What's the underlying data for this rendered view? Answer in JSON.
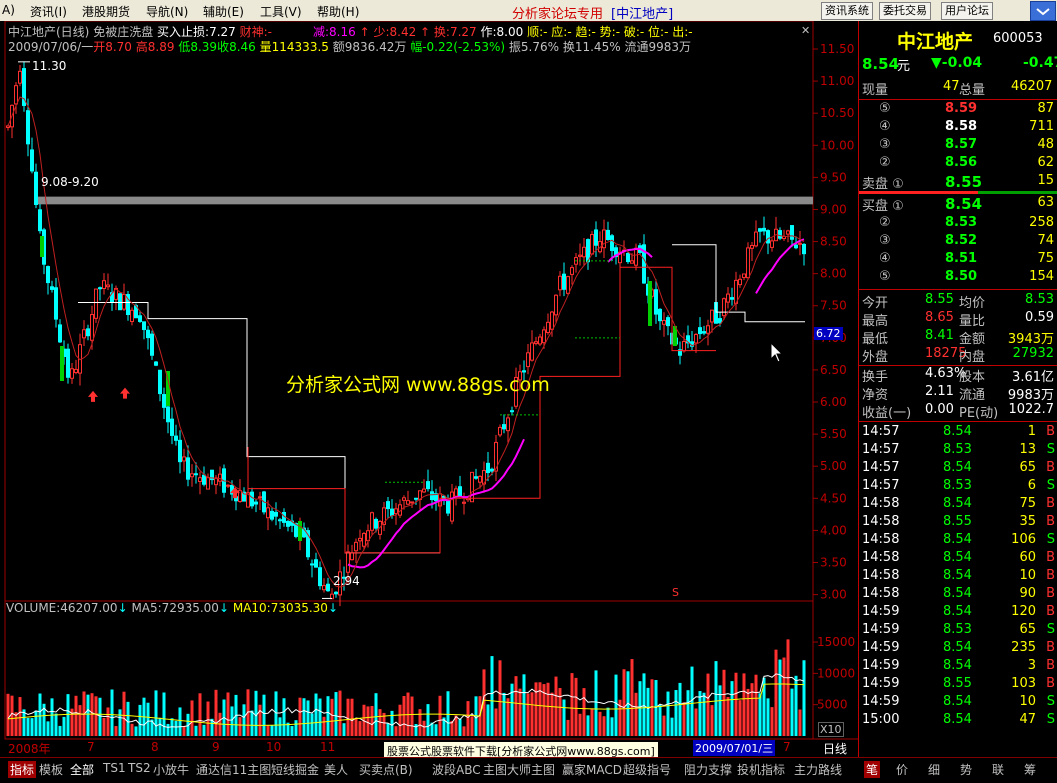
{
  "menubar": {
    "items": [
      "A)",
      "资讯(I)",
      "港股期货",
      "导航(N)",
      "辅助(E)",
      "工具(V)",
      "帮助(H)"
    ],
    "title": "分析家论坛专用",
    "stock_tag": "[中江地产]",
    "buttons": [
      "资讯系统",
      "委托交易",
      "用户论坛"
    ]
  },
  "chart": {
    "header_line1": {
      "name": "中江地产(日线)",
      "indicator": "免被庄洗盘",
      "stoploss": "买入止损:7.27",
      "caishen": "财神:-",
      "jian": "减:8.16",
      "shao": "少:8.42",
      "huan": "换:7.27",
      "zuo": "作:8.00",
      "tail": "顺:- 应:- 趋:- 势:- 破:- 位:- 出:-"
    },
    "header_line2": {
      "date": "2009/07/06/一",
      "open": "开8.70",
      "high": "高8.89",
      "low": "低8.39",
      "close": "收8.46",
      "vol": "量114333.5",
      "amount": "额9836.42万",
      "change": "幅-0.22(-2.53%)",
      "amp": "振5.76%",
      "turnover": "换11.45%",
      "float": "流通9983万"
    },
    "annotations": {
      "high_mark": "11.30",
      "low_mark": "2.94",
      "band": "9.08-9.20",
      "watermark": "分析家公式网 www.88gs.com",
      "price_tag": "6.72",
      "s_mark": "S"
    },
    "volume_header": {
      "volume": "VOLUME:46207.00",
      "ma5": "MA5:72935.00",
      "ma10": "MA10:73035.30"
    },
    "date_axis": [
      "2008年",
      "7",
      "8",
      "9",
      "10",
      "11",
      "7"
    ],
    "date_highlight": "2009/07/01/三",
    "tooltip": "股票公式股票软件下载[分析家公式网www.88gs.com]",
    "period_label": "日线",
    "x10": "X10",
    "price_ticks": [
      "11.50",
      "11.00",
      "10.50",
      "10.00",
      "9.50",
      "9.00",
      "8.50",
      "8.00",
      "7.50",
      "7.00",
      "6.50",
      "6.00",
      "5.50",
      "5.00",
      "4.50",
      "4.00",
      "3.50",
      "3.00"
    ],
    "vol_ticks": [
      "15000",
      "10000",
      "5000"
    ],
    "colors": {
      "up": "#ff3030",
      "down": "#00ffff",
      "ma5": "#ffffff",
      "ma10": "#ffff00",
      "ma_magenta": "#ff00ff"
    }
  },
  "chart_data": {
    "type": "candlestick",
    "title": "中江地产(日线)",
    "ylim": [
      2.9,
      11.5
    ],
    "price_marks": {
      "high": 11.3,
      "low": 2.94,
      "last": 8.46,
      "band": [
        9.08,
        9.2
      ]
    },
    "volume_ylim": [
      0,
      19000
    ]
  },
  "quote": {
    "name": "中江地产",
    "code": "600053",
    "price": "8.54",
    "unit": "元",
    "change": "▼-0.04",
    "change_pct": "-0.47",
    "xianliang_label": "现量",
    "xianliang": "47",
    "zongliang_label": "总量",
    "zongliang": "46207",
    "sell": [
      {
        "lvl": "⑤",
        "price": "8.59",
        "vol": "87"
      },
      {
        "lvl": "④",
        "price": "8.58",
        "vol": "711"
      },
      {
        "lvl": "③",
        "price": "8.57",
        "vol": "48"
      },
      {
        "lvl": "②",
        "price": "8.56",
        "vol": "62"
      },
      {
        "lvl": "卖盘 ①",
        "price": "8.55",
        "vol": "15"
      }
    ],
    "buy": [
      {
        "lvl": "买盘 ①",
        "price": "8.54",
        "vol": "63"
      },
      {
        "lvl": "②",
        "price": "8.53",
        "vol": "258"
      },
      {
        "lvl": "③",
        "price": "8.52",
        "vol": "74"
      },
      {
        "lvl": "④",
        "price": "8.51",
        "vol": "75"
      },
      {
        "lvl": "⑤",
        "price": "8.50",
        "vol": "154"
      }
    ],
    "stats": [
      {
        "l1": "今开",
        "v1": "8.55",
        "l2": "均价",
        "v2": "8.53"
      },
      {
        "l1": "最高",
        "v1": "8.65",
        "l2": "量比",
        "v2": "0.59"
      },
      {
        "l1": "最低",
        "v1": "8.41",
        "l2": "金额",
        "v2": "3943万"
      },
      {
        "l1": "外盘",
        "v1": "18275",
        "l2": "内盘",
        "v2": "27932"
      },
      {
        "l1": "换手",
        "v1": "4.63%",
        "l2": "股本",
        "v2": "3.61亿"
      },
      {
        "l1": "净资",
        "v1": "2.11",
        "l2": "流通",
        "v2": "9983万"
      },
      {
        "l1": "收益(一)",
        "v1": "0.00",
        "l2": "PE(动)",
        "v2": "1022.7"
      }
    ],
    "ticks": [
      {
        "t": "14:57",
        "p": "8.54",
        "v": "1",
        "d": "B"
      },
      {
        "t": "14:57",
        "p": "8.53",
        "v": "13",
        "d": "S"
      },
      {
        "t": "14:57",
        "p": "8.54",
        "v": "65",
        "d": "B"
      },
      {
        "t": "14:57",
        "p": "8.53",
        "v": "6",
        "d": "S"
      },
      {
        "t": "14:58",
        "p": "8.54",
        "v": "75",
        "d": "B"
      },
      {
        "t": "14:58",
        "p": "8.55",
        "v": "35",
        "d": "B"
      },
      {
        "t": "14:58",
        "p": "8.54",
        "v": "106",
        "d": "S"
      },
      {
        "t": "14:58",
        "p": "8.54",
        "v": "60",
        "d": "B"
      },
      {
        "t": "14:58",
        "p": "8.54",
        "v": "10",
        "d": "B"
      },
      {
        "t": "14:58",
        "p": "8.54",
        "v": "90",
        "d": "B"
      },
      {
        "t": "14:59",
        "p": "8.54",
        "v": "120",
        "d": "B"
      },
      {
        "t": "14:59",
        "p": "8.53",
        "v": "65",
        "d": "S"
      },
      {
        "t": "14:59",
        "p": "8.54",
        "v": "235",
        "d": "B"
      },
      {
        "t": "14:59",
        "p": "8.54",
        "v": "3",
        "d": "B"
      },
      {
        "t": "14:59",
        "p": "8.55",
        "v": "103",
        "d": "B"
      },
      {
        "t": "14:59",
        "p": "8.54",
        "v": "10",
        "d": "S"
      },
      {
        "t": "15:00",
        "p": "8.54",
        "v": "47",
        "d": "S"
      }
    ]
  },
  "bottombar": {
    "tabs": [
      "指标",
      "模板",
      "全部",
      "TS1",
      "TS2",
      "小放牛",
      "通达信11主图",
      "短线掘金",
      "美人",
      "买卖点(B)",
      "波段ABC",
      "主图大师主图",
      "赢家MACD",
      "超级指号",
      "阻力支撑",
      "投机指标",
      "主力路线"
    ],
    "right_tabs": [
      "笔",
      "价",
      "细",
      "势",
      "联",
      "筹"
    ]
  }
}
